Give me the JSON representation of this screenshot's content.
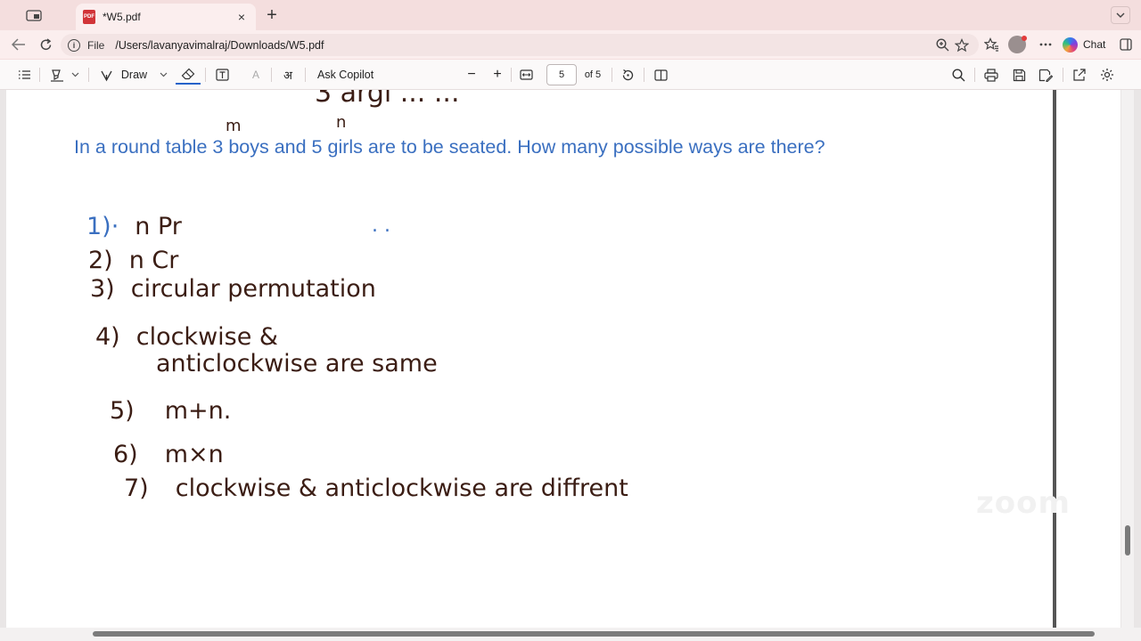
{
  "tab": {
    "title": "*W5.pdf",
    "close": "×",
    "new": "+"
  },
  "address": {
    "scheme_label": "File",
    "url": "/Users/lavanyavimalraj/Downloads/W5.pdf"
  },
  "chat": {
    "label": "Chat"
  },
  "toolbar": {
    "draw_label": "Draw",
    "ask_label": "Ask Copilot",
    "zoom_out": "−",
    "zoom_in": "+",
    "page_current": "5",
    "page_total": "of 5",
    "highlight_glyph": "अ",
    "text_glyph": "A"
  },
  "document": {
    "top_fragment": "3  argi  ...  ...",
    "question": "In a round table 3 boys and 5 girls are to be seated. How many possible ways are there?",
    "annot_m": "m",
    "annot_n": "n",
    "dots": ". .",
    "answers": [
      {
        "num": "1)·",
        "text": "n Pr"
      },
      {
        "num": "2)",
        "text": "n Cr"
      },
      {
        "num": "3)",
        "text": "circular  permutation"
      },
      {
        "num": "4)",
        "text": "clockwise &"
      },
      {
        "num": "",
        "text": "anticlockwise  are same"
      },
      {
        "num": "5)",
        "text": "m+n."
      },
      {
        "num": "6)",
        "text": "m×n"
      },
      {
        "num": "7)",
        "text": "clockwise & anticlockwise   are  diffrent"
      }
    ],
    "watermark": "zoom"
  }
}
